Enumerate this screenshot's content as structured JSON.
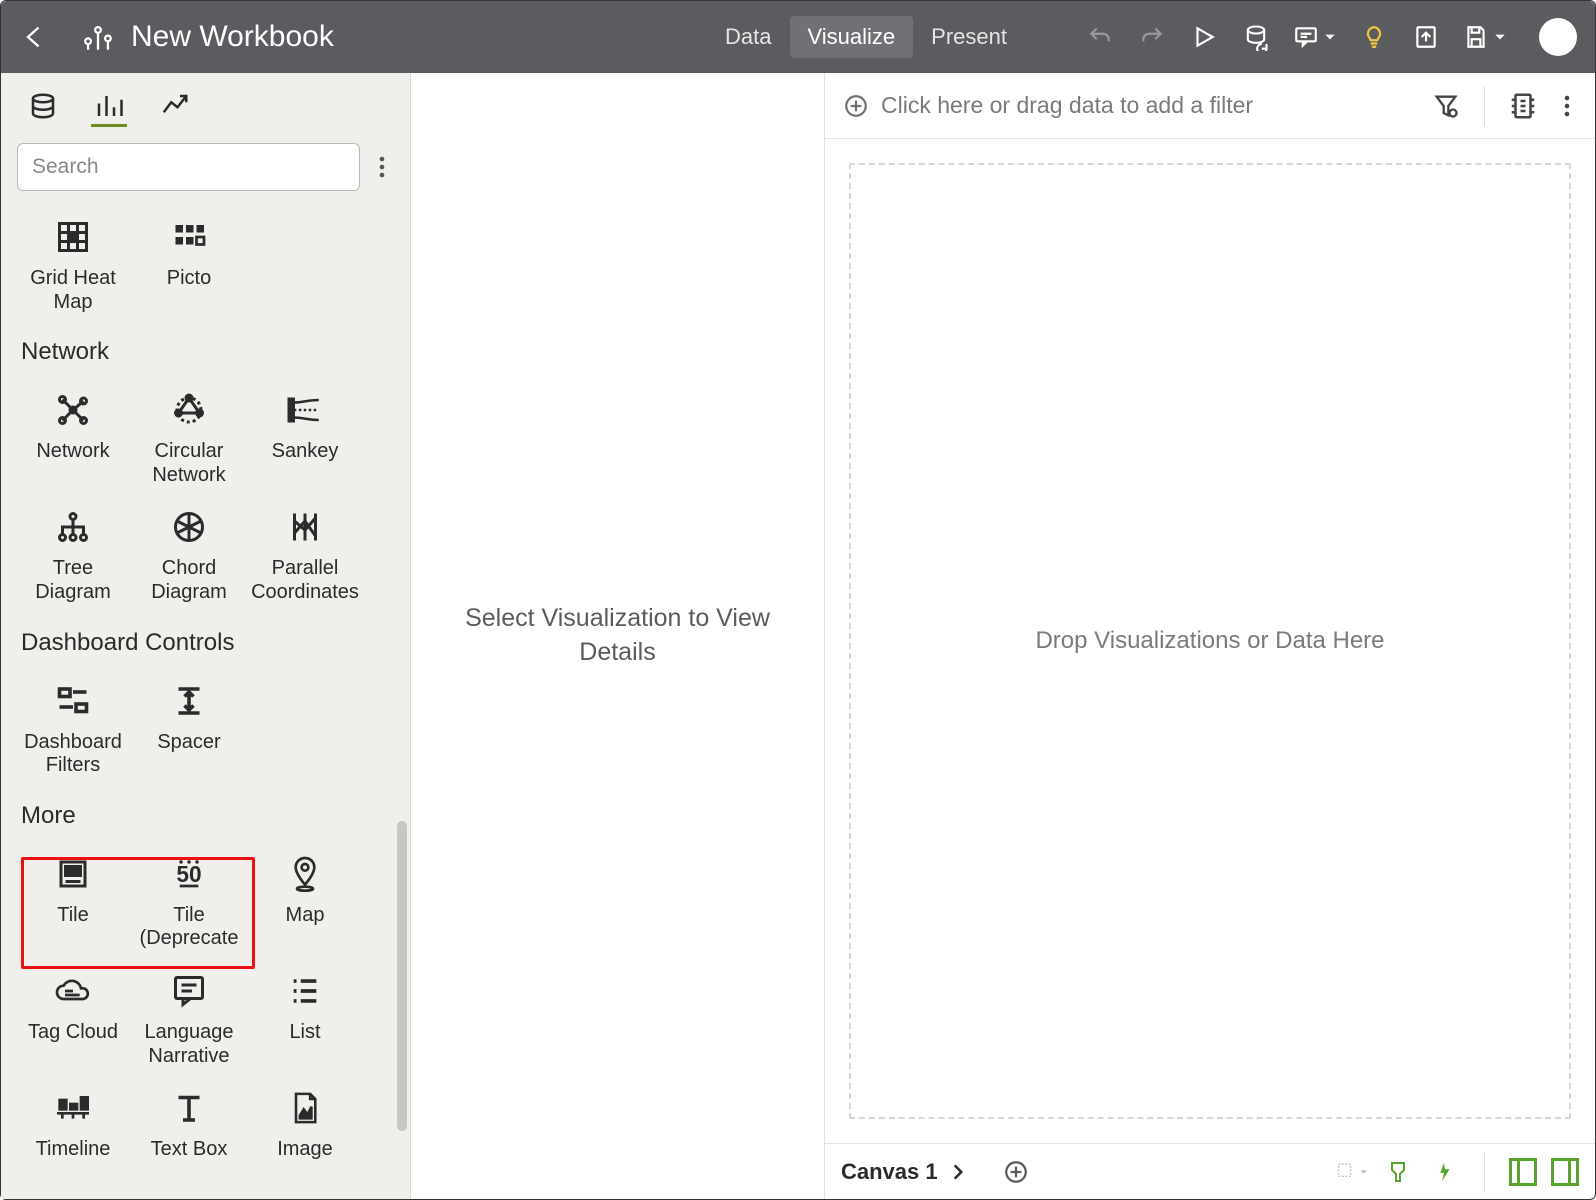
{
  "header": {
    "title": "New Workbook",
    "tabs": {
      "data": "Data",
      "visualize": "Visualize",
      "present": "Present"
    }
  },
  "sidebar": {
    "search_placeholder": "Search",
    "top_items": [
      {
        "label": "Grid Heat Map"
      },
      {
        "label": "Picto"
      }
    ],
    "cat_network": "Network",
    "network_items": [
      {
        "label": "Network"
      },
      {
        "label": "Circular Network"
      },
      {
        "label": "Sankey"
      },
      {
        "label": "Tree Diagram"
      },
      {
        "label": "Chord Diagram"
      },
      {
        "label": "Parallel Coordinates"
      }
    ],
    "cat_dash": "Dashboard Controls",
    "dash_items": [
      {
        "label": "Dashboard Filters"
      },
      {
        "label": "Spacer"
      }
    ],
    "cat_more": "More",
    "more_items": [
      {
        "label": "Tile"
      },
      {
        "label": "Tile (Deprecate"
      },
      {
        "label": "Map"
      },
      {
        "label": "Tag Cloud"
      },
      {
        "label": "Language Narrative"
      },
      {
        "label": "List"
      },
      {
        "label": "Timeline"
      },
      {
        "label": "Text Box"
      },
      {
        "label": "Image"
      }
    ]
  },
  "detail_panel": {
    "message": "Select Visualization to View Details"
  },
  "filter_bar": {
    "prompt": "Click here or drag data to add a filter"
  },
  "canvas": {
    "drop_hint": "Drop Visualizations or Data Here",
    "tab_label": "Canvas 1"
  }
}
